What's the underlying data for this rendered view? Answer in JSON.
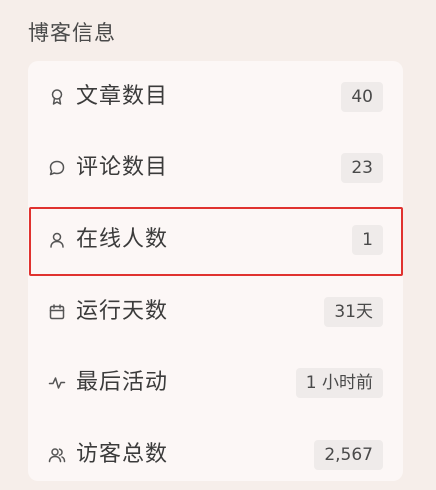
{
  "section": {
    "title": "博客信息"
  },
  "stats": [
    {
      "label": "文章数目",
      "value": "40",
      "icon": "badge-icon"
    },
    {
      "label": "评论数目",
      "value": "23",
      "icon": "comment-icon"
    },
    {
      "label": "在线人数",
      "value": "1",
      "icon": "user-icon"
    },
    {
      "label": "运行天数",
      "value": "31天",
      "icon": "calendar-icon"
    },
    {
      "label": "最后活动",
      "value": "1 小时前",
      "icon": "activity-icon"
    },
    {
      "label": "访客总数",
      "value": "2,567",
      "icon": "users-icon"
    }
  ],
  "highlight_color": "#e0322f"
}
